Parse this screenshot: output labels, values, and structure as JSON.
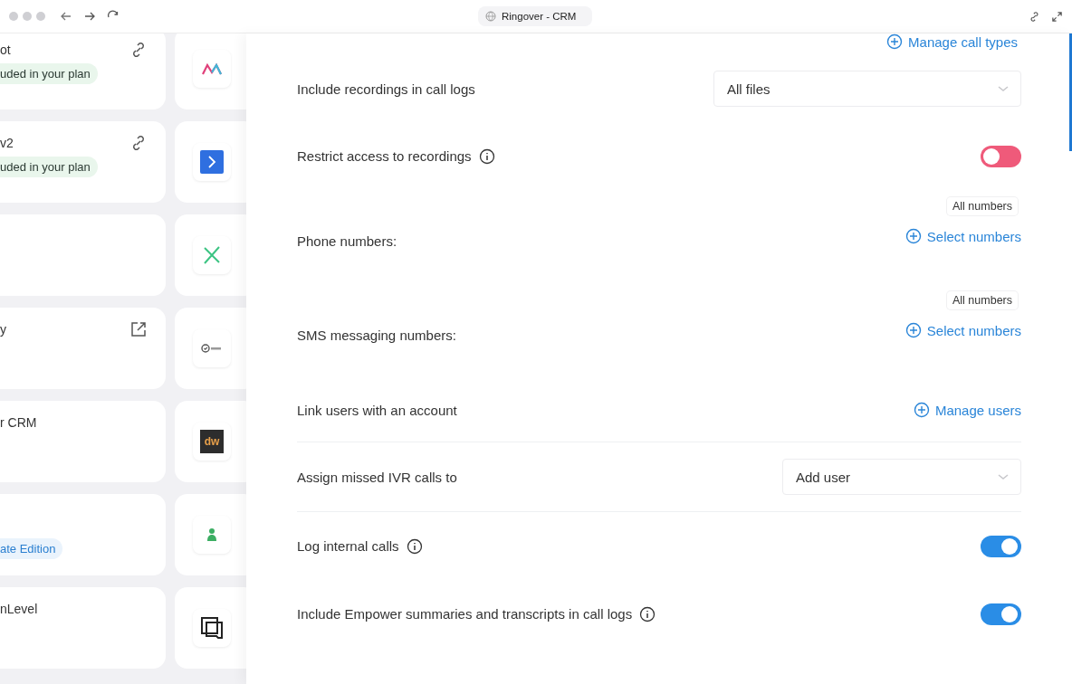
{
  "browser": {
    "title": "Ringover - CRM"
  },
  "cards": [
    {
      "kind": "link",
      "title": "ot",
      "badge": {
        "text": "uded in your plan",
        "color": "#e9f6ec"
      }
    },
    {
      "kind": "link",
      "title": "v2",
      "badge": {
        "text": "uded in your plan",
        "color": "#e9f6ec"
      }
    },
    {
      "kind": "plain"
    },
    {
      "kind": "external",
      "title": "y"
    },
    {
      "kind": "plain",
      "title": "r CRM"
    },
    {
      "kind": "plain",
      "badge": {
        "text": "ate Edition",
        "color": "#eaf3fc"
      }
    },
    {
      "kind": "plain",
      "title": "nLevel"
    }
  ],
  "tiles": [
    {
      "kind": "mountains"
    },
    {
      "kind": "chevron"
    },
    {
      "kind": "cross"
    },
    {
      "kind": "check"
    },
    {
      "kind": "dw",
      "text": "dw"
    },
    {
      "kind": "person"
    },
    {
      "kind": "chat"
    }
  ],
  "settings": {
    "top_link": "Manage call types",
    "rows": [
      {
        "kind": "select",
        "label": "Include recordings in call logs",
        "value": "All files",
        "wide": true
      },
      {
        "kind": "toggle",
        "label": "Restrict access to recordings",
        "info": true,
        "on": false
      },
      {
        "kind": "numbers",
        "label": "Phone numbers:",
        "tag": "All numbers",
        "link": "Select numbers"
      },
      {
        "kind": "numbers",
        "label": "SMS messaging numbers:",
        "tag": "All numbers",
        "link": "Select numbers"
      },
      {
        "kind": "link",
        "label": "Link users with an account",
        "link": "Manage users"
      },
      {
        "kind": "select",
        "label": "Assign missed IVR calls to",
        "value": "Add user",
        "wide": false
      },
      {
        "kind": "toggle",
        "label": "Log internal calls",
        "info": true,
        "on": true
      },
      {
        "kind": "toggle",
        "label": "Include Empower summaries and transcripts in call logs",
        "info": true,
        "on": true
      }
    ]
  }
}
